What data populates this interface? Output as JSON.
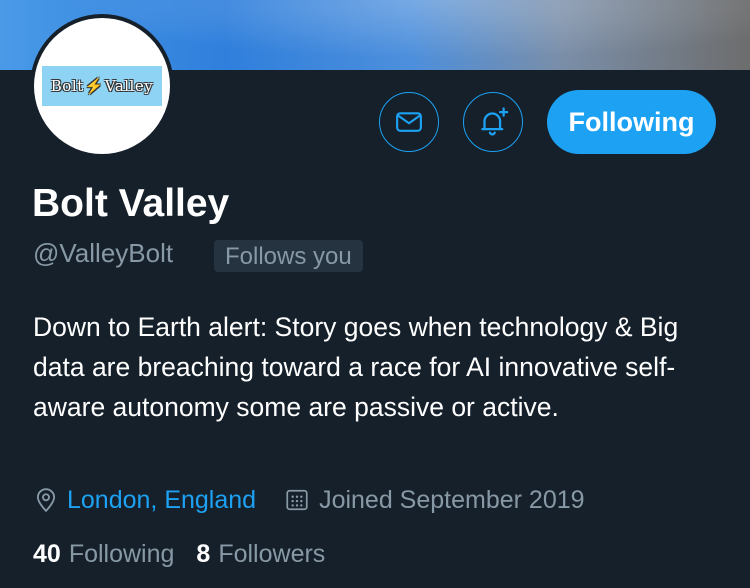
{
  "profile": {
    "logo_text_left": "Bolt",
    "logo_text_right": "Valley",
    "name": "Bolt Valley",
    "handle": "@ValleyBolt",
    "follows_you_badge": "Follows you",
    "bio": "Down to Earth alert: Story goes when technology & Big data are breaching toward a race for AI innovative self-aware autonomy some are passive or active.",
    "location": "London, England",
    "joined": "Joined September 2019"
  },
  "actions": {
    "message_icon": "envelope-icon",
    "notify_icon": "bell-plus-icon",
    "follow_label": "Following"
  },
  "stats": {
    "following_count": "40",
    "following_label": "Following",
    "followers_count": "8",
    "followers_label": "Followers"
  },
  "colors": {
    "accent": "#1da1f2",
    "background": "#15202b",
    "secondary_text": "#8899a6"
  }
}
